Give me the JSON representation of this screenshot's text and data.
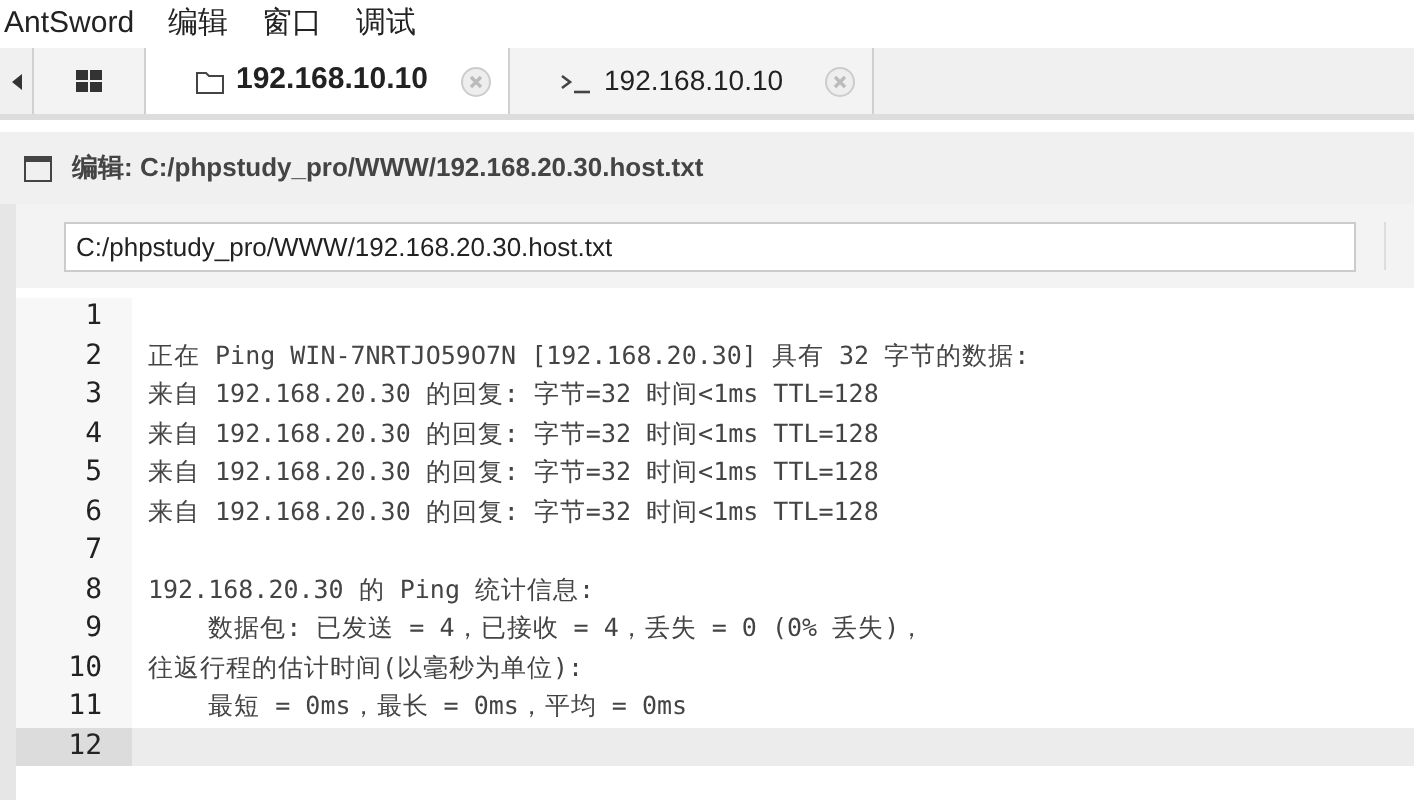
{
  "menu": [
    "AntSword",
    "编辑",
    "窗口",
    "调试"
  ],
  "tabs": [
    {
      "kind": "home",
      "selected": false
    },
    {
      "kind": "folder",
      "label": "192.168.10.10",
      "selected": true
    },
    {
      "kind": "terminal",
      "label": "192.168.10.10",
      "selected": false
    }
  ],
  "panel": {
    "title": "编辑: C:/phpstudy_pro/WWW/192.168.20.30.host.txt",
    "path": "C:/phpstudy_pro/WWW/192.168.20.30.host.txt"
  },
  "editor": {
    "lines": [
      {
        "number": "1",
        "active": false
      },
      {
        "number": "2",
        "text": "正在 Ping WIN-7NRTJO59O7N [192.168.20.30] 具有 32 字节的数据:",
        "active": false
      },
      {
        "number": "3",
        "text": "来自 192.168.20.30 的回复: 字节=32 时间<1ms TTL=128",
        "active": false
      },
      {
        "number": "4",
        "text": "来自 192.168.20.30 的回复: 字节=32 时间<1ms TTL=128",
        "active": false
      },
      {
        "number": "5",
        "text": "来自 192.168.20.30 的回复: 字节=32 时间<1ms TTL=128",
        "active": false
      },
      {
        "number": "6",
        "text": "来自 192.168.20.30 的回复: 字节=32 时间<1ms TTL=128",
        "active": false
      },
      {
        "number": "7",
        "active": false
      },
      {
        "number": "8",
        "text": "192.168.20.30 的 Ping 统计信息:",
        "active": false
      },
      {
        "number": "9",
        "text": "    数据包: 已发送 = 4，已接收 = 4，丢失 = 0 (0% 丢失)，",
        "active": false
      },
      {
        "number": "10",
        "text": "往返行程的估计时间(以毫秒为单位):",
        "active": false
      },
      {
        "number": "11",
        "text": "    最短 = 0ms，最长 = 0ms，平均 = 0ms",
        "active": false
      },
      {
        "number": "12",
        "active": true
      }
    ]
  }
}
